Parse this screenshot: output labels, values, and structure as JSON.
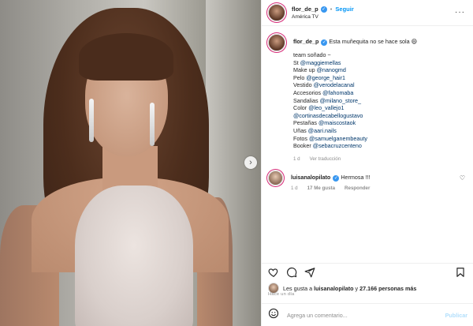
{
  "post": {
    "username": "flor_de_p",
    "verified_glyph": "✓",
    "dot": "•",
    "follow_label": "Seguir",
    "location": "América TV",
    "more_glyph": "···"
  },
  "caption": {
    "username": "flor_de_p",
    "text": "Esta muñequita no se hace sola 😄",
    "lines": [
      {
        "pre": "team soñado ~",
        "mention": ""
      },
      {
        "pre": "St ",
        "mention": "@maggiemellas"
      },
      {
        "pre": "Make up ",
        "mention": "@nanogmd"
      },
      {
        "pre": "Pelo ",
        "mention": "@george_hair1"
      },
      {
        "pre": "Vestido ",
        "mention": "@verodelacanal"
      },
      {
        "pre": "Accesorios ",
        "mention": "@fahomaba"
      },
      {
        "pre": "Sandalias ",
        "mention": "@milano_store_"
      },
      {
        "pre": "Color ",
        "mention": "@leo_vallejo1"
      },
      {
        "pre": "",
        "mention": "@cortinasdecabellogustavo"
      },
      {
        "pre": "Pestañas ",
        "mention": "@maiscostaok"
      },
      {
        "pre": "Uñas ",
        "mention": "@aari.nails"
      },
      {
        "pre": "Fotos ",
        "mention": "@samuelganembeauty"
      },
      {
        "pre": "Booker ",
        "mention": "@sebacruzcenteno"
      }
    ],
    "time": "1 d",
    "translate": "Ver traducción"
  },
  "comment": {
    "username": "luisanalopilato",
    "text": "Hermosa !!!",
    "time": "1 d",
    "likes": "17 Me gusta",
    "reply": "Responder"
  },
  "likes": {
    "prefix": "Les gusta a ",
    "user": "luisanalopilato",
    "middle": " y ",
    "count": "27.166 personas más"
  },
  "time_ago": "Hace un día",
  "add_comment": {
    "placeholder": "Agrega un comentario...",
    "publish": "Publicar"
  },
  "colors": {
    "accent": "#0095f6",
    "mention": "#00376b",
    "muted": "#8e8e8e",
    "verified": "#3897f0"
  },
  "icons": [
    "heart-icon",
    "comment-icon",
    "share-icon",
    "bookmark-icon",
    "emoji-icon",
    "more-icon",
    "next-arrow-icon"
  ]
}
